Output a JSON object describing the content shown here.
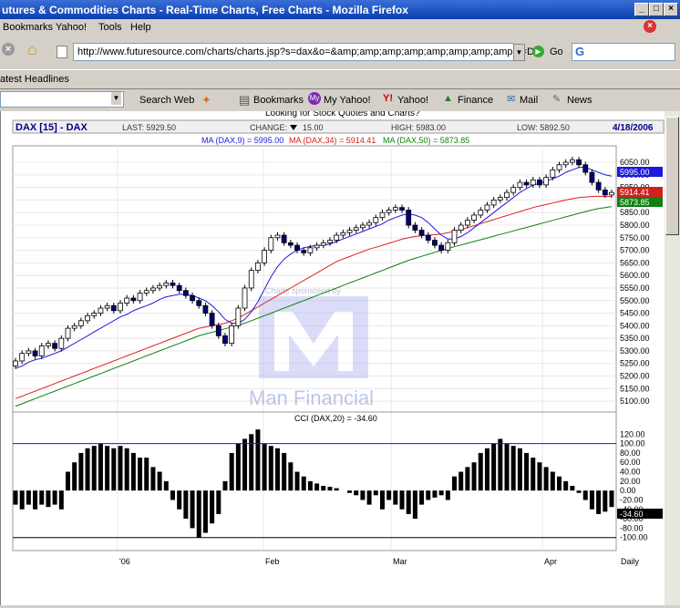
{
  "window": {
    "title": "utures & Commodities Charts - Real-Time Charts, Free Charts - Mozilla Firefox",
    "controls": [
      "_",
      "□",
      "×"
    ]
  },
  "menu": [
    "Bookmarks",
    "Yahoo!",
    "Tools",
    "Help"
  ],
  "nav": {
    "url": "http://www.futuresource.com/charts/charts.jsp?s=dax&o=&amp;amp;amp;amp;amp;amp;amp;amp;a=D",
    "go_label": "Go",
    "search_logo": "G"
  },
  "bookmarks": {
    "item": "atest Headlines"
  },
  "yahoo_toolbar": {
    "search": "Search Web",
    "items": [
      "Bookmarks",
      "My Yahoo!",
      "Yahoo!",
      "Finance",
      "Mail",
      "News"
    ]
  },
  "page": {
    "link_text": "Looking for Stock Quotes and Charts?"
  },
  "chart_header": {
    "symbol": "DAX [15] - DAX",
    "last": "LAST: 5929.50",
    "change": "CHANGE:",
    "change_value": "15.00",
    "high": "HIGH: 5983.00",
    "low": "LOW: 5892.50",
    "date": "4/18/2006",
    "ma9": "MA (DAX,9) = 5995.00",
    "ma34": "MA (DAX,34) = 5914.41",
    "ma50": "MA (DAX,50) = 5873.85",
    "cci": "CCI (DAX,20) = -34.60",
    "watermark_top": "Charts sponsored by",
    "watermark": "Man Financial"
  },
  "chart_data": {
    "type": "candlestick",
    "price_axis": [
      "6050.00",
      "6000.00",
      "5950.00",
      "5900.00",
      "5850.00",
      "5800.00",
      "5750.00",
      "5700.00",
      "5650.00",
      "5600.00",
      "5550.00",
      "5500.00",
      "5450.00",
      "5400.00",
      "5350.00",
      "5300.00",
      "5250.00",
      "5200.00",
      "5150.00",
      "5100.00"
    ],
    "price_range": [
      5075,
      6090
    ],
    "last_labels": {
      "ma9": "5995.00",
      "last": "5929.50",
      "ma34": "5914.41",
      "ma50": "5873.85"
    },
    "cci_axis": [
      "120.00",
      "100.00",
      "80.00",
      "60.00",
      "40.00",
      "20.00",
      "0.00",
      "-20.00",
      "-40.00",
      "-60.00",
      "-80.00",
      "-100.00"
    ],
    "cci_range": [
      -120,
      140
    ],
    "cci_last": "-34.60",
    "x_labels": [
      "'06",
      "Feb",
      "Mar",
      "Apr",
      "Daily"
    ],
    "closes": [
      5260,
      5290,
      5300,
      5280,
      5320,
      5330,
      5310,
      5350,
      5390,
      5400,
      5420,
      5440,
      5450,
      5470,
      5480,
      5460,
      5490,
      5510,
      5500,
      5530,
      5540,
      5550,
      5560,
      5570,
      5560,
      5540,
      5520,
      5500,
      5480,
      5450,
      5400,
      5360,
      5330,
      5400,
      5470,
      5550,
      5620,
      5650,
      5700,
      5750,
      5760,
      5730,
      5720,
      5700,
      5690,
      5710,
      5720,
      5730,
      5740,
      5760,
      5770,
      5780,
      5790,
      5800,
      5810,
      5830,
      5850,
      5860,
      5870,
      5860,
      5800,
      5780,
      5760,
      5740,
      5720,
      5700,
      5730,
      5780,
      5800,
      5820,
      5840,
      5860,
      5880,
      5900,
      5910,
      5930,
      5950,
      5970,
      5960,
      5980,
      5960,
      5990,
      6020,
      6040,
      6050,
      6060,
      6040,
      6010,
      5970,
      5940,
      5920,
      5930
    ],
    "ma9": [
      5230,
      5240,
      5255,
      5265,
      5270,
      5280,
      5290,
      5300,
      5315,
      5330,
      5345,
      5360,
      5375,
      5390,
      5405,
      5420,
      5435,
      5445,
      5460,
      5470,
      5480,
      5490,
      5505,
      5515,
      5520,
      5525,
      5525,
      5520,
      5510,
      5500,
      5480,
      5455,
      5425,
      5410,
      5410,
      5425,
      5455,
      5495,
      5545,
      5595,
      5635,
      5665,
      5685,
      5700,
      5710,
      5715,
      5720,
      5720,
      5725,
      5735,
      5745,
      5755,
      5765,
      5775,
      5785,
      5795,
      5805,
      5820,
      5830,
      5840,
      5845,
      5840,
      5830,
      5810,
      5785,
      5760,
      5745,
      5745,
      5755,
      5770,
      5790,
      5810,
      5830,
      5850,
      5870,
      5890,
      5910,
      5930,
      5945,
      5960,
      5965,
      5975,
      5985,
      5995,
      6010,
      6020,
      6030,
      6030,
      6020,
      6010,
      6000,
      5995
    ],
    "ma34": [
      5110,
      5120,
      5130,
      5140,
      5150,
      5160,
      5170,
      5180,
      5190,
      5200,
      5210,
      5220,
      5230,
      5240,
      5250,
      5260,
      5270,
      5280,
      5290,
      5300,
      5310,
      5320,
      5330,
      5340,
      5350,
      5360,
      5370,
      5380,
      5390,
      5395,
      5400,
      5405,
      5410,
      5420,
      5430,
      5445,
      5460,
      5475,
      5490,
      5505,
      5520,
      5535,
      5550,
      5565,
      5580,
      5595,
      5610,
      5625,
      5640,
      5655,
      5665,
      5675,
      5685,
      5695,
      5705,
      5712,
      5720,
      5728,
      5736,
      5744,
      5750,
      5755,
      5758,
      5760,
      5762,
      5765,
      5770,
      5775,
      5782,
      5790,
      5798,
      5806,
      5814,
      5822,
      5830,
      5838,
      5846,
      5854,
      5862,
      5870,
      5876,
      5882,
      5888,
      5894,
      5900,
      5905,
      5910,
      5912,
      5914,
      5915,
      5914,
      5914
    ],
    "ma50": [
      5080,
      5090,
      5100,
      5110,
      5120,
      5130,
      5140,
      5150,
      5160,
      5170,
      5180,
      5190,
      5200,
      5210,
      5220,
      5230,
      5240,
      5250,
      5260,
      5270,
      5280,
      5290,
      5300,
      5310,
      5320,
      5330,
      5340,
      5350,
      5360,
      5367,
      5374,
      5381,
      5388,
      5395,
      5402,
      5410,
      5420,
      5430,
      5440,
      5450,
      5460,
      5470,
      5480,
      5490,
      5500,
      5510,
      5520,
      5530,
      5540,
      5550,
      5560,
      5570,
      5580,
      5590,
      5600,
      5610,
      5620,
      5630,
      5640,
      5650,
      5660,
      5668,
      5676,
      5684,
      5692,
      5700,
      5707,
      5714,
      5721,
      5728,
      5735,
      5742,
      5749,
      5756,
      5763,
      5770,
      5777,
      5784,
      5791,
      5798,
      5805,
      5812,
      5819,
      5826,
      5833,
      5840,
      5847,
      5854,
      5860,
      5866,
      5870,
      5874
    ],
    "cci": [
      -30,
      -40,
      -30,
      -40,
      -30,
      -35,
      -30,
      -40,
      40,
      60,
      80,
      90,
      95,
      100,
      95,
      90,
      95,
      90,
      80,
      70,
      70,
      50,
      40,
      20,
      -20,
      -40,
      -60,
      -80,
      -100,
      -90,
      -70,
      -50,
      20,
      80,
      100,
      110,
      120,
      130,
      100,
      95,
      90,
      80,
      60,
      40,
      30,
      20,
      15,
      10,
      8,
      5,
      0,
      -5,
      -10,
      -20,
      -30,
      -10,
      -40,
      -20,
      -30,
      -40,
      -50,
      -60,
      -30,
      -20,
      -15,
      -10,
      -20,
      30,
      40,
      50,
      60,
      80,
      90,
      100,
      110,
      100,
      95,
      90,
      80,
      70,
      60,
      50,
      40,
      30,
      20,
      10,
      -5,
      -20,
      -40,
      -50,
      -45,
      -35
    ]
  }
}
